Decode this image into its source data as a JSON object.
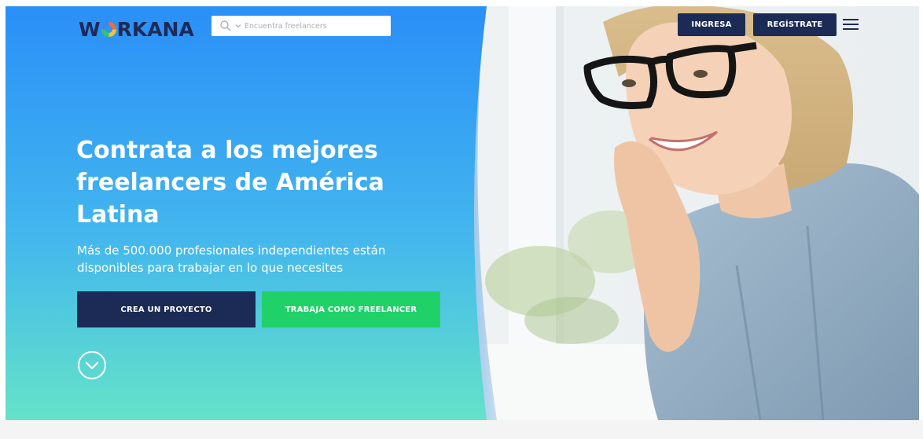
{
  "header": {
    "logo_parts": [
      "W",
      "RKANA"
    ],
    "search": {
      "placeholder": "Encuentra freelancers",
      "icon": "search-icon",
      "dropdown_icon": "chevron-down-icon"
    },
    "login_label": "INGRESA",
    "register_label": "REGÍSTRATE",
    "menu_icon": "hamburger-menu-icon"
  },
  "hero": {
    "title": "Contrata a los mejores freelancers de América Latina",
    "subtitle": "Más de 500.000 profesionales independientes están disponibles para trabajar en lo que necesites",
    "cta_primary": "CREA UN PROYECTO",
    "cta_secondary": "TRABAJA COMO FREELANCER",
    "scroll_icon": "chevron-down-circle-icon"
  },
  "colors": {
    "gradient_top": "#2a8ff7",
    "gradient_bottom": "#5fe3c6",
    "navy": "#1b2b55",
    "green": "#20d16a"
  }
}
